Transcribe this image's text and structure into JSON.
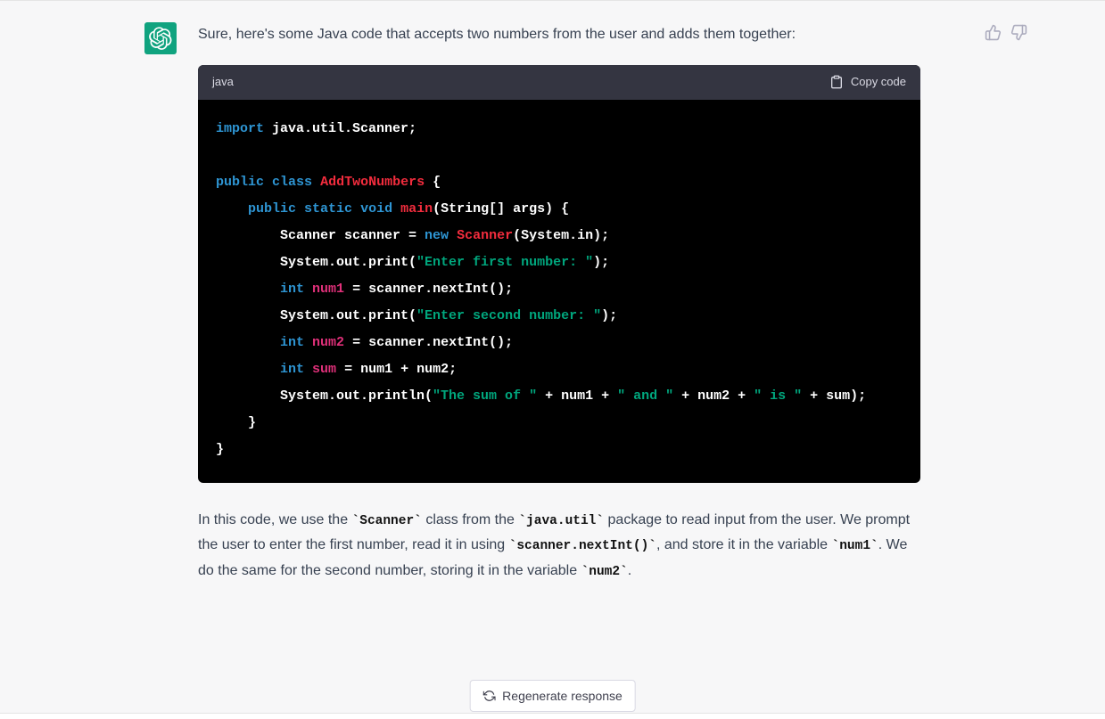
{
  "avatar": {
    "name": "assistant-avatar"
  },
  "intro": "Sure, here's some Java code that accepts two numbers from the user and adds them together:",
  "code_lang": "java",
  "copy_label": "Copy code",
  "code": {
    "l1_import": "import",
    "l1_rest": " java.util.Scanner;",
    "l3_public": "public",
    "l3_class": "class",
    "l3_name": "AddTwoNumbers",
    "l3_brace": " {",
    "l4_indent": "    ",
    "l4_public": "public",
    "l4_static": "static",
    "l4_void": "void",
    "l4_main": "main",
    "l4_sig": "(String[] args) {",
    "l5_indent": "        Scanner scanner = ",
    "l5_new": "new",
    "l5_scannercls": "Scanner",
    "l5_rest": "(System.in);",
    "l6_indent": "        System.out.print(",
    "l6_str": "\"Enter first number: \"",
    "l6_rest": ");",
    "l7_indent": "        ",
    "l7_int": "int",
    "l7_var": "num1",
    "l7_rest": " = scanner.nextInt();",
    "l8_indent": "        System.out.print(",
    "l8_str": "\"Enter second number: \"",
    "l8_rest": ");",
    "l9_indent": "        ",
    "l9_int": "int",
    "l9_var": "num2",
    "l9_rest": " = scanner.nextInt();",
    "l10_indent": "        ",
    "l10_int": "int",
    "l10_var": "sum",
    "l10_rest": " = num1 + num2;",
    "l11_indent": "        System.out.println(",
    "l11_str1": "\"The sum of \"",
    "l11_p1": " + num1 + ",
    "l11_str2": "\" and \"",
    "l11_p2": " + num2 + ",
    "l11_str3": "\" is \"",
    "l11_p3": " + sum);",
    "l12": "    }",
    "l13": "}"
  },
  "explain": {
    "t1": "In this code, we use the ",
    "c1": "`Scanner`",
    "t2": " class from the ",
    "c2": "`java.util`",
    "t3": " package to read input from the user. We prompt the user to enter the first number, read it in using ",
    "c3": "`scanner.nextInt()`",
    "t4": ", and store it in the variable ",
    "c4": "`num1`",
    "t5": ". We do the same for the second number, storing it in the variable ",
    "c5": "`num2`",
    "t6": "."
  },
  "regen_label": "Regenerate response"
}
